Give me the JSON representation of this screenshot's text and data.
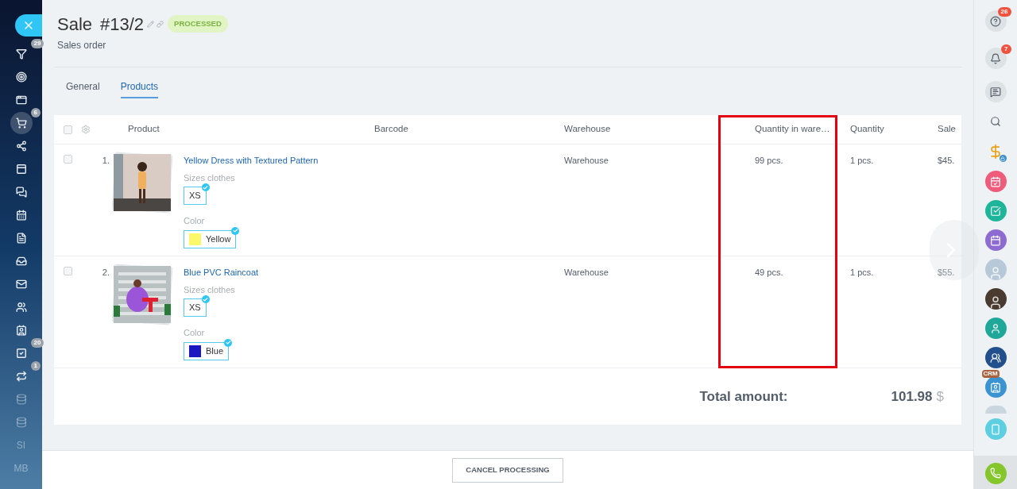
{
  "sidebar": {
    "items": [
      {
        "kind": "icon",
        "badge": "29",
        "selected": false
      },
      {
        "kind": "icon",
        "selected": false
      },
      {
        "kind": "icon",
        "selected": false
      },
      {
        "kind": "icon",
        "badge": "6",
        "selected": true
      },
      {
        "kind": "icon",
        "selected": false
      },
      {
        "kind": "icon",
        "selected": false
      },
      {
        "kind": "icon",
        "selected": false
      },
      {
        "kind": "icon",
        "selected": false
      },
      {
        "kind": "icon",
        "selected": false
      },
      {
        "kind": "icon",
        "selected": false
      },
      {
        "kind": "icon",
        "selected": false
      },
      {
        "kind": "icon",
        "selected": false
      },
      {
        "kind": "icon",
        "selected": false
      },
      {
        "kind": "icon",
        "badge": "20",
        "selected": false
      },
      {
        "kind": "icon",
        "badge": "1",
        "selected": false
      },
      {
        "kind": "icon",
        "selected": false
      },
      {
        "kind": "icon",
        "selected": false
      },
      {
        "kind": "text",
        "label": "SI",
        "selected": false
      },
      {
        "kind": "text",
        "label": "MB",
        "selected": false
      }
    ]
  },
  "header": {
    "title": "Sale",
    "number": "#13/2",
    "status": "PROCESSED",
    "subtitle": "Sales order"
  },
  "tabs": [
    {
      "label": "General",
      "selected": false
    },
    {
      "label": "Products",
      "selected": true
    }
  ],
  "table": {
    "select_all": {
      "checked": false
    },
    "columns": [
      {
        "label": "Product",
        "highlighted": false
      },
      {
        "label": "Barcode",
        "highlighted": false
      },
      {
        "label": "Warehouse",
        "highlighted": false
      },
      {
        "label": "Quantity in ware…",
        "highlighted": true
      },
      {
        "label": "Quantity",
        "highlighted": false
      },
      {
        "label": "Sale",
        "highlighted": false
      }
    ],
    "rows": [
      {
        "number": "1.",
        "name": "Yellow Dress with Textured Pattern",
        "size_label": "Sizes clothes",
        "size": {
          "label": "XS",
          "selected": true
        },
        "color_label": "Color",
        "color": {
          "label": "Yellow",
          "color": "#fbf96b",
          "selected": true
        },
        "warehouse": "Warehouse",
        "stock": "99 pcs.",
        "quantity": "1 pcs.",
        "sale": "$45.",
        "checked": false
      },
      {
        "number": "2.",
        "name": "Blue PVC Raincoat",
        "size_label": "Sizes clothes",
        "size": {
          "label": "XS",
          "selected": true
        },
        "color_label": "Color",
        "color": {
          "label": "Blue",
          "color": "#1a18c0",
          "selected": true
        },
        "warehouse": "Warehouse",
        "stock": "49 pcs.",
        "quantity": "1 pcs.",
        "sale": "$55.",
        "checked": false
      }
    ],
    "total": {
      "label": "Total amount:",
      "value": "101.98",
      "currency": "$"
    }
  },
  "footer": {
    "button": "CANCEL PROCESSING"
  },
  "right_bar": {
    "items": [
      {
        "kind": "round",
        "badge": "26"
      },
      {
        "kind": "round",
        "badge": "7"
      },
      {
        "kind": "round"
      },
      {
        "kind": "plain"
      },
      {
        "kind": "plain"
      },
      {
        "kind": "app",
        "color": "#ef5b7a"
      },
      {
        "kind": "app",
        "color": "#1fb59a"
      },
      {
        "kind": "app",
        "color": "#8d6bd0"
      },
      {
        "kind": "avatar",
        "color": "#b7c9d8"
      },
      {
        "kind": "avatar",
        "color": "#4a3b30"
      },
      {
        "kind": "app",
        "color": "#1fa89a"
      },
      {
        "kind": "app",
        "color": "#22508d"
      },
      {
        "kind": "crm",
        "label": "CRM",
        "color": "#3b94d1"
      },
      {
        "kind": "partial"
      },
      {
        "kind": "app",
        "color": "#5ecfe0"
      },
      {
        "kind": "phone",
        "color": "#84c62b"
      }
    ]
  }
}
